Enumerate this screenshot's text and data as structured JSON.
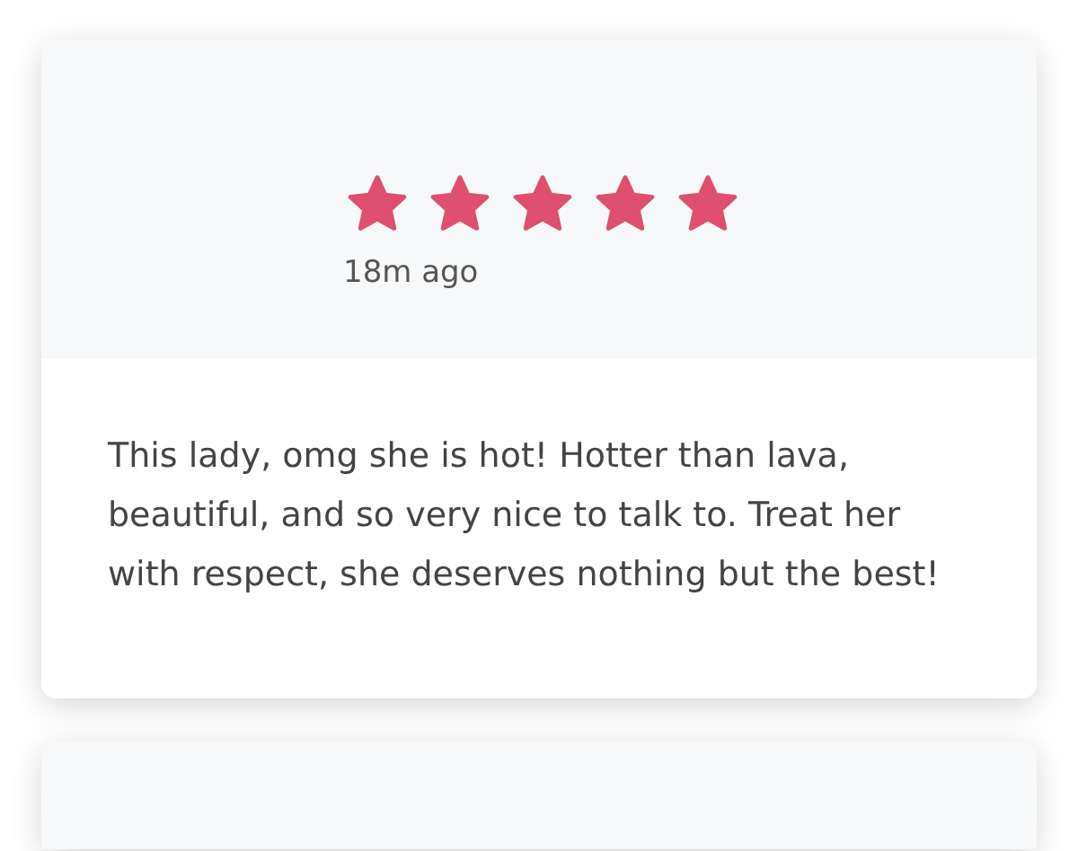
{
  "review": {
    "stars": 5,
    "time": "18m ago",
    "text": "This lady, omg she is hot! Hotter than lava, beautiful, and so very nice to talk to. Treat her with respect, she deserves nothing but the best!"
  }
}
